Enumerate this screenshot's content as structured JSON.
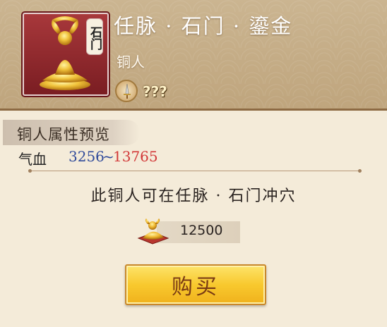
{
  "header": {
    "title": "任脉 · 石门 · 鎏金",
    "subtitle": "铜人",
    "portrait_tag": "石门",
    "badge_text": "???"
  },
  "attributes": {
    "section_label": "铜人属性预览",
    "stat_name": "气血",
    "stat_low": "3256",
    "stat_sep": "~",
    "stat_high": "13765"
  },
  "description": "此铜人可在任脉 · 石门冲穴",
  "price": {
    "amount": "12500",
    "icon": "gold-statue-icon"
  },
  "buy_button_label": "购买",
  "colors": {
    "stat_low": "#2f4a9a",
    "stat_high": "#d23838",
    "button_gold": "#f8c92e",
    "portrait_bg": "#8b2a2d"
  }
}
